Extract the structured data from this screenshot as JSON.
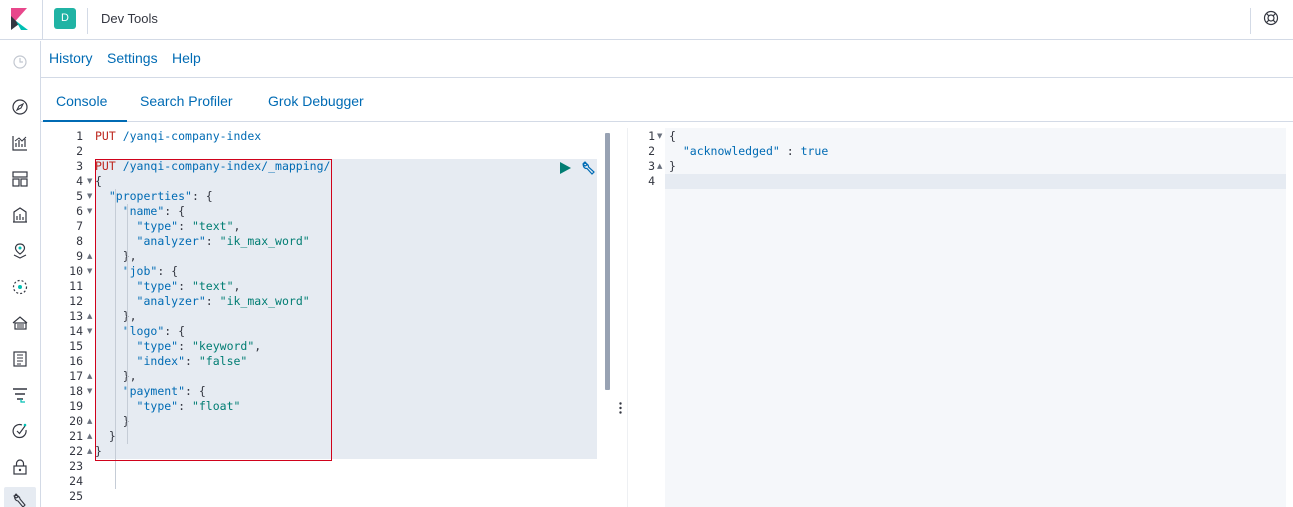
{
  "header": {
    "space_initial": "D",
    "app_title": "Dev Tools",
    "icons": [
      "elastic-logo-icon",
      "help-lifebuoy-icon"
    ]
  },
  "sidenav": {
    "icons": [
      "recently-viewed-icon",
      "discover-compass-icon",
      "visualize-icon",
      "dashboard-icon",
      "canvas-icon",
      "maps-icon",
      "machine-learning-icon",
      "infrastructure-icon",
      "logs-icon",
      "apm-icon",
      "uptime-icon",
      "security-icon",
      "dev-tools-icon"
    ]
  },
  "menu": {
    "history": "History",
    "settings": "Settings",
    "help": "Help"
  },
  "tabs": {
    "console": "Console",
    "search_profiler": "Search Profiler",
    "grok_debugger": "Grok Debugger",
    "active": "Console"
  },
  "editor": {
    "line_numbers": [
      "1",
      "2",
      "3",
      "4",
      "5",
      "6",
      "7",
      "8",
      "9",
      "10",
      "11",
      "12",
      "13",
      "14",
      "15",
      "16",
      "17",
      "18",
      "19",
      "20",
      "21",
      "22",
      "23",
      "24",
      "25"
    ],
    "lines": [
      {
        "n": "1",
        "parts": [
          {
            "t": "PUT",
            "c": "verb"
          },
          {
            "t": " /yanqi-company-index",
            "c": "url"
          }
        ]
      },
      {
        "n": "2",
        "parts": []
      },
      {
        "n": "3",
        "parts": [
          {
            "t": "PUT",
            "c": "verb"
          },
          {
            "t": " /yanqi-company-index/_mapping/",
            "c": "url"
          }
        ]
      },
      {
        "n": "4",
        "parts": [
          {
            "t": "{",
            "c": "punc"
          }
        ]
      },
      {
        "n": "5",
        "parts": [
          {
            "t": "  ",
            "c": "punc"
          },
          {
            "t": "\"properties\"",
            "c": "key"
          },
          {
            "t": ": {",
            "c": "punc"
          }
        ]
      },
      {
        "n": "6",
        "parts": [
          {
            "t": "    ",
            "c": "punc"
          },
          {
            "t": "\"name\"",
            "c": "key"
          },
          {
            "t": ": {",
            "c": "punc"
          }
        ]
      },
      {
        "n": "7",
        "parts": [
          {
            "t": "      ",
            "c": "punc"
          },
          {
            "t": "\"type\"",
            "c": "key"
          },
          {
            "t": ": ",
            "c": "punc"
          },
          {
            "t": "\"text\"",
            "c": "str"
          },
          {
            "t": ",",
            "c": "punc"
          }
        ]
      },
      {
        "n": "8",
        "parts": [
          {
            "t": "      ",
            "c": "punc"
          },
          {
            "t": "\"analyzer\"",
            "c": "key"
          },
          {
            "t": ": ",
            "c": "punc"
          },
          {
            "t": "\"ik_max_word\"",
            "c": "str"
          }
        ]
      },
      {
        "n": "9",
        "parts": [
          {
            "t": "    },",
            "c": "punc"
          }
        ]
      },
      {
        "n": "10",
        "parts": [
          {
            "t": "    ",
            "c": "punc"
          },
          {
            "t": "\"job\"",
            "c": "key"
          },
          {
            "t": ": {",
            "c": "punc"
          }
        ]
      },
      {
        "n": "11",
        "parts": [
          {
            "t": "      ",
            "c": "punc"
          },
          {
            "t": "\"type\"",
            "c": "key"
          },
          {
            "t": ": ",
            "c": "punc"
          },
          {
            "t": "\"text\"",
            "c": "str"
          },
          {
            "t": ",",
            "c": "punc"
          }
        ]
      },
      {
        "n": "12",
        "parts": [
          {
            "t": "      ",
            "c": "punc"
          },
          {
            "t": "\"analyzer\"",
            "c": "key"
          },
          {
            "t": ": ",
            "c": "punc"
          },
          {
            "t": "\"ik_max_word\"",
            "c": "str"
          }
        ]
      },
      {
        "n": "13",
        "parts": [
          {
            "t": "    },",
            "c": "punc"
          }
        ]
      },
      {
        "n": "14",
        "parts": [
          {
            "t": "    ",
            "c": "punc"
          },
          {
            "t": "\"logo\"",
            "c": "key"
          },
          {
            "t": ": {",
            "c": "punc"
          }
        ]
      },
      {
        "n": "15",
        "parts": [
          {
            "t": "      ",
            "c": "punc"
          },
          {
            "t": "\"type\"",
            "c": "key"
          },
          {
            "t": ": ",
            "c": "punc"
          },
          {
            "t": "\"keyword\"",
            "c": "str"
          },
          {
            "t": ",",
            "c": "punc"
          }
        ]
      },
      {
        "n": "16",
        "parts": [
          {
            "t": "      ",
            "c": "punc"
          },
          {
            "t": "\"index\"",
            "c": "key"
          },
          {
            "t": ": ",
            "c": "punc"
          },
          {
            "t": "\"false\"",
            "c": "str"
          }
        ]
      },
      {
        "n": "17",
        "parts": [
          {
            "t": "    },",
            "c": "punc"
          }
        ]
      },
      {
        "n": "18",
        "parts": [
          {
            "t": "    ",
            "c": "punc"
          },
          {
            "t": "\"payment\"",
            "c": "key"
          },
          {
            "t": ": {",
            "c": "punc"
          }
        ]
      },
      {
        "n": "19",
        "parts": [
          {
            "t": "      ",
            "c": "punc"
          },
          {
            "t": "\"type\"",
            "c": "key"
          },
          {
            "t": ": ",
            "c": "punc"
          },
          {
            "t": "\"float\"",
            "c": "str"
          }
        ]
      },
      {
        "n": "20",
        "parts": [
          {
            "t": "    }",
            "c": "punc"
          }
        ]
      },
      {
        "n": "21",
        "parts": [
          {
            "t": "  }",
            "c": "punc"
          }
        ]
      },
      {
        "n": "22",
        "parts": [
          {
            "t": "}",
            "c": "punc"
          }
        ]
      },
      {
        "n": "23",
        "parts": []
      },
      {
        "n": "24",
        "parts": []
      },
      {
        "n": "25",
        "parts": []
      }
    ],
    "fold_down": [
      "4",
      "5",
      "6",
      "10",
      "14",
      "18"
    ],
    "fold_up": [
      "9",
      "13",
      "17",
      "20",
      "21",
      "22"
    ],
    "icons": [
      "send-request-play-icon",
      "wrench-options-icon"
    ]
  },
  "output": {
    "lines": [
      {
        "n": "1",
        "parts": [
          {
            "t": "{",
            "c": "punc"
          }
        ]
      },
      {
        "n": "2",
        "parts": [
          {
            "t": "  ",
            "c": "punc"
          },
          {
            "t": "\"acknowledged\"",
            "c": "key"
          },
          {
            "t": " : ",
            "c": "punc"
          },
          {
            "t": "true",
            "c": "bool"
          }
        ]
      },
      {
        "n": "3",
        "parts": [
          {
            "t": "}",
            "c": "punc"
          }
        ]
      },
      {
        "n": "4",
        "parts": []
      }
    ],
    "fold_down": [
      "1"
    ],
    "fold_up": [
      "3"
    ]
  }
}
